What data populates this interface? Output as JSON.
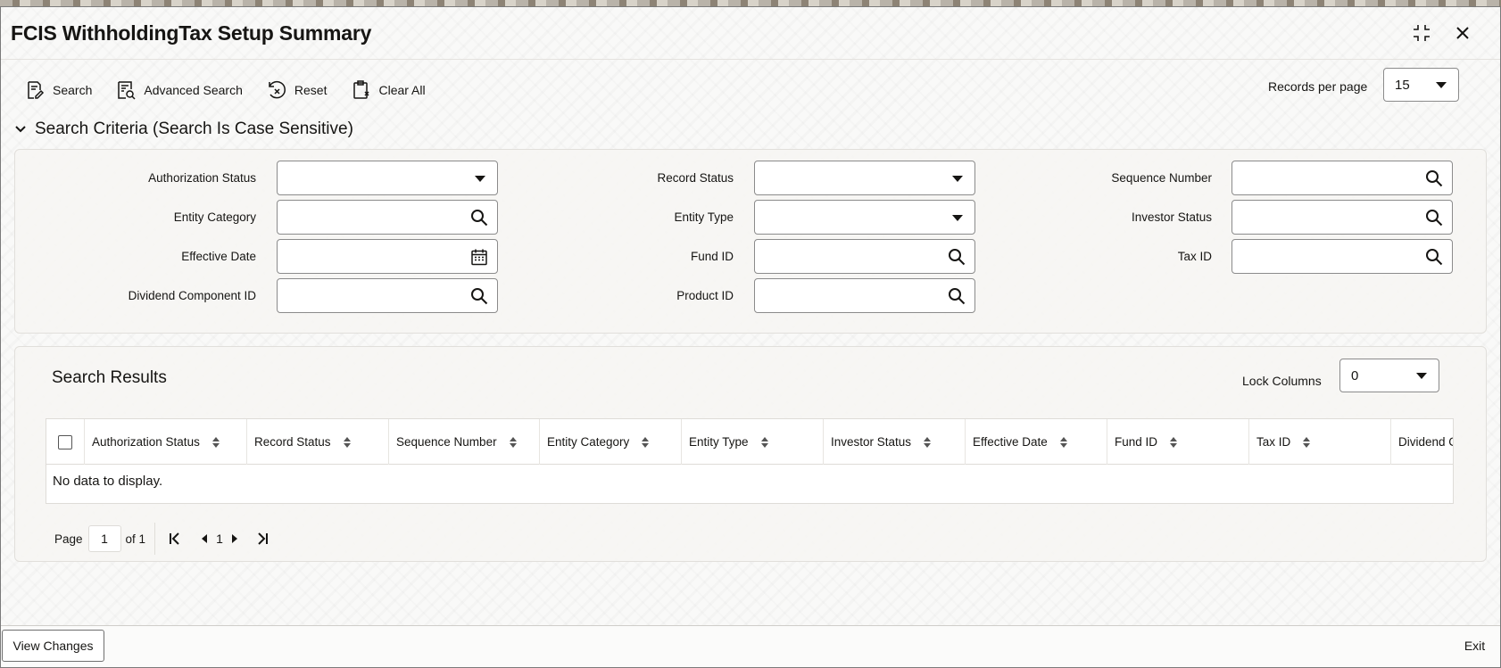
{
  "window": {
    "title": "FCIS WithholdingTax Setup Summary",
    "icons": [
      "collapse-icon",
      "close-icon"
    ]
  },
  "toolbar": {
    "search": "Search",
    "advanced_search": "Advanced Search",
    "reset": "Reset",
    "clear_all": "Clear All",
    "records_per_page_label": "Records per page",
    "records_per_page_value": "15"
  },
  "criteria": {
    "heading": "Search Criteria (Search Is Case Sensitive)",
    "fields": {
      "authorization_status": "Authorization Status",
      "record_status": "Record Status",
      "sequence_number": "Sequence Number",
      "entity_category": "Entity Category",
      "entity_type": "Entity Type",
      "investor_status": "Investor Status",
      "effective_date": "Effective Date",
      "fund_id": "Fund ID",
      "tax_id": "Tax ID",
      "dividend_component_id": "Dividend Component ID",
      "product_id": "Product ID"
    }
  },
  "results": {
    "heading": "Search Results",
    "lock_columns_label": "Lock Columns",
    "lock_columns_value": "0",
    "columns": [
      "Authorization Status",
      "Record Status",
      "Sequence Number",
      "Entity Category",
      "Entity Type",
      "Investor Status",
      "Effective Date",
      "Fund ID",
      "Tax ID",
      "Dividend C"
    ],
    "empty_message": "No data to display.",
    "pager": {
      "page_label": "Page",
      "page_value": "1",
      "of_label": "of 1",
      "current": "1"
    }
  },
  "footer": {
    "view_changes": "View Changes",
    "exit": "Exit"
  },
  "colors": {
    "text": "#161513",
    "border": "#8b8b8b",
    "panel": "#f6f5f3"
  }
}
